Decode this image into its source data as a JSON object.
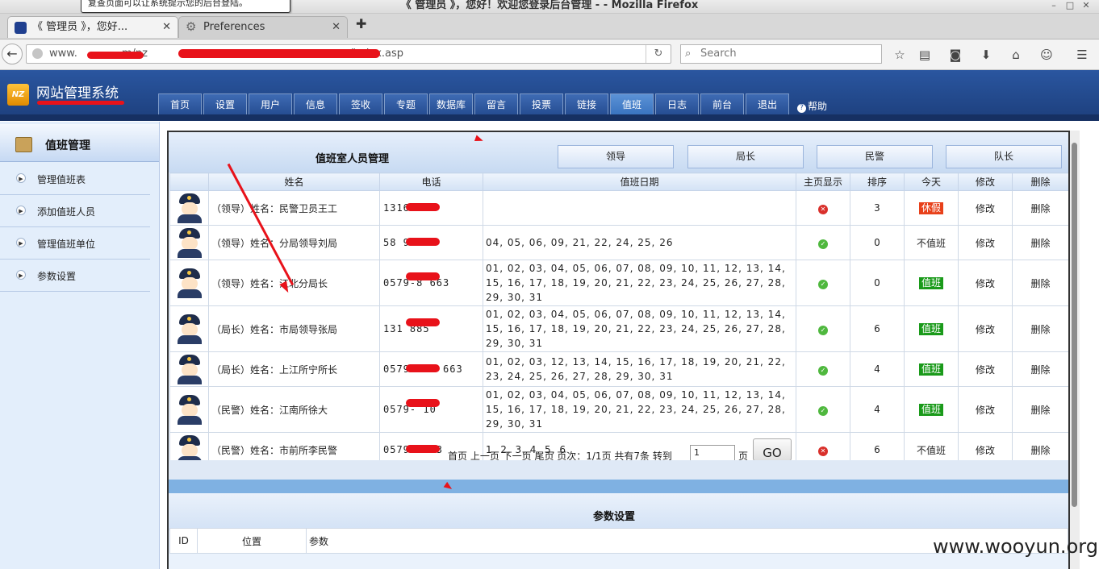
{
  "window": {
    "title": "《 管理员 》，您好！欢迎您登录后台管理 - - Mozilla Firefox",
    "tooltip": "复查页面可以让系统提示您的后台登陆。"
  },
  "tabs": [
    {
      "label": "《 管理员 》，您好...",
      "active": true
    },
    {
      "label": "Preferences",
      "active": false
    }
  ],
  "nav": {
    "url_prefix": "www.",
    "url_mid": "m/nz",
    "url_suffix": "/index.asp",
    "search_placeholder": "Search"
  },
  "app": {
    "logo_text": "NZ",
    "system_name": "网站管理系统",
    "menu": [
      "首页",
      "设置",
      "用户",
      "信息",
      "签收",
      "专题",
      "数据库",
      "留言",
      "投票",
      "链接",
      "值班",
      "日志",
      "前台",
      "退出"
    ],
    "active_menu": "值班",
    "help_label": "帮助"
  },
  "sidebar": {
    "title": "值班管理",
    "items": [
      "管理值班表",
      "添加值班人员",
      "管理值班单位",
      "参数设置"
    ]
  },
  "panel": {
    "title": "值班室人员管理",
    "buttons": [
      "领导",
      "局长",
      "民警",
      "队长"
    ],
    "columns": [
      "",
      "姓名",
      "电话",
      "值班日期",
      "主页显示",
      "排序",
      "今天",
      "修改",
      "删除"
    ],
    "rows": [
      {
        "name": "（领导）姓名：民警卫员王工",
        "phone": "1316      885",
        "dates": "",
        "show": false,
        "order": "3",
        "today": "休假",
        "today_style": "leave",
        "edit": "修改",
        "delete": "删除"
      },
      {
        "name": "（领导）姓名：分局领导刘局",
        "phone": "58        99",
        "dates": "04, 05, 06, 09, 21, 22, 24, 25, 26",
        "show": true,
        "order": "0",
        "today": "不值班",
        "today_style": "plain",
        "edit": "修改",
        "delete": "删除"
      },
      {
        "name": "（领导）姓名：江北分局长",
        "phone": "0579-8      663",
        "dates": "01, 02, 03, 04, 05, 06, 07, 08, 09, 10, 11, 12, 13, 14, 15, 16, 17, 18, 19, 20, 21, 22, 23, 24, 25, 26, 27, 28, 29, 30, 31",
        "show": true,
        "order": "0",
        "today": "值班",
        "today_style": "duty",
        "edit": "修改",
        "delete": "删除"
      },
      {
        "name": "（局长）姓名：市局领导张局",
        "phone": "131       885",
        "dates": "01, 02, 03, 04, 05, 06, 07, 08, 09, 10, 11, 12, 13, 14, 15, 16, 17, 18, 19, 20, 21, 22, 23, 24, 25, 26, 27, 28, 29, 30, 31",
        "show": true,
        "order": "6",
        "today": "值班",
        "today_style": "duty",
        "edit": "修改",
        "delete": "删除"
      },
      {
        "name": "（局长）姓名：上江所宁所长",
        "phone": "0579-839   663",
        "dates": "01, 02, 03, 12, 13, 14, 15, 16, 17, 18, 19, 20, 21, 22, 23, 24, 25, 26, 27, 28, 29, 30, 31",
        "show": true,
        "order": "4",
        "today": "值班",
        "today_style": "duty",
        "edit": "修改",
        "delete": "删除"
      },
      {
        "name": "（民警）姓名：江南所徐大",
        "phone": "0579-     10",
        "dates": "01, 02, 03, 04, 05, 06, 07, 08, 09, 10, 11, 12, 13, 14, 15, 16, 17, 18, 19, 20, 21, 22, 23, 24, 25, 26, 27, 28, 29, 30, 31",
        "show": true,
        "order": "4",
        "today": "值班",
        "today_style": "duty",
        "edit": "修改",
        "delete": "删除"
      },
      {
        "name": "（民警）姓名：市前所李民警",
        "phone": "0579-    663",
        "dates": "1, 2, 3, 4, 5, 6",
        "show": false,
        "order": "6",
        "today": "不值班",
        "today_style": "plain",
        "edit": "修改",
        "delete": "删除"
      }
    ],
    "pager_text": "首页 上一页 下一页 尾页 页次：1/1页 共有7条 转到",
    "pager_input": "1",
    "pager_unit": "页",
    "go_label": "GO"
  },
  "params": {
    "title": "参数设置",
    "columns": [
      "ID",
      "位置",
      "参数"
    ]
  },
  "watermark": "www.wooyun.org",
  "colors": {
    "header_blue": "#2a56a0",
    "duty_green": "#1a9a1a",
    "leave_red": "#e8401a",
    "redaction": "#e8121a"
  }
}
